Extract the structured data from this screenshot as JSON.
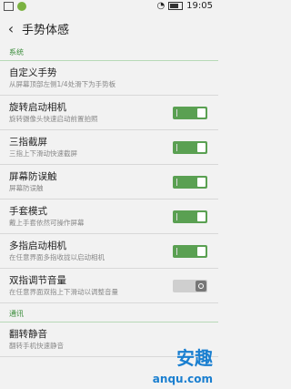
{
  "status_bar": {
    "time": "19:05"
  },
  "header": {
    "title": "手势体感"
  },
  "sections": [
    {
      "label": "系统"
    },
    {
      "label": "通讯"
    }
  ],
  "rows": [
    {
      "title": "自定义手势",
      "subtitle": "从屏幕顶部左侧1/4处滑下为手势板"
    },
    {
      "title": "旋转启动相机",
      "subtitle": "旋转摄像头快速启动前置拍照",
      "on": true
    },
    {
      "title": "三指截屏",
      "subtitle": "三指上下滑动快速截屏",
      "on": true
    },
    {
      "title": "屏幕防误触",
      "subtitle": "屏幕防误触",
      "on": true
    },
    {
      "title": "手套模式",
      "subtitle": "戴上手套依然可操作屏幕",
      "on": true
    },
    {
      "title": "多指启动相机",
      "subtitle": "在任意界面多指收拢以启动相机",
      "on": true
    },
    {
      "title": "双指调节音量",
      "subtitle": "在任意界面双指上下滑动以调整音量",
      "on": false
    },
    {
      "title": "翻转静音",
      "subtitle": "翻转手机快速静音"
    }
  ],
  "watermark": {
    "cn": "安趣",
    "en": "anqu.com"
  }
}
